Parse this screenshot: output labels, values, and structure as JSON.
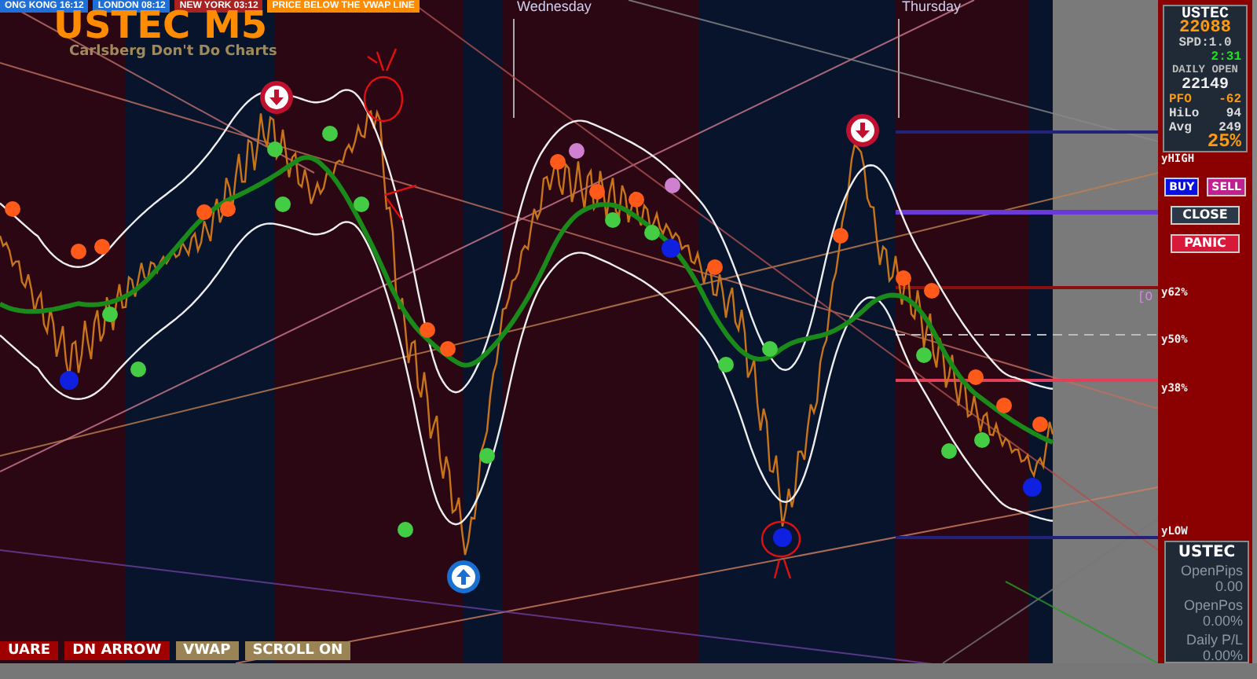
{
  "sessions": [
    {
      "label": "ONG KONG 16:12",
      "color": "#1f6fd6"
    },
    {
      "label": "LONDON 08:12",
      "color": "#1f6fd6"
    },
    {
      "label": "NEW YORK 03:12",
      "color": "#a82222"
    },
    {
      "label": "PRICE BELOW THE VWAP LINE",
      "color": "#ff8c00"
    }
  ],
  "chart": {
    "title": "USTEC M5",
    "subtitle": "Carlsberg Don't Do Charts",
    "day_labels": [
      "Wednesday",
      "Thursday"
    ],
    "order_label": "[O",
    "level_labels": [
      {
        "label": "yHIGH"
      },
      {
        "label": "y62%"
      },
      {
        "label": "y50%"
      },
      {
        "label": "y38%"
      },
      {
        "label": "yLOW"
      }
    ]
  },
  "info_panel": {
    "symbol": "USTEC",
    "price": "22088",
    "spread": "SPD:1.0",
    "timer": "2:31",
    "daily_open_label": "DAILY OPEN",
    "daily_open": "22149",
    "stats": [
      {
        "label": "PFO",
        "value": "-62",
        "kind": "accent"
      },
      {
        "label": "HiLo",
        "value": "94",
        "kind": "plain"
      },
      {
        "label": "Avg",
        "value": "249",
        "kind": "plain"
      }
    ],
    "percent": "25%"
  },
  "trade_buttons": [
    {
      "label": "BUY",
      "kind": "buy"
    },
    {
      "label": "SELL",
      "kind": "sell"
    },
    {
      "label": "CLOSE",
      "kind": "close"
    },
    {
      "label": "PANIC",
      "kind": "panic"
    }
  ],
  "position_panel": {
    "symbol": "USTEC",
    "rows": [
      {
        "label": "OpenPips",
        "value": "0.00"
      },
      {
        "label": "OpenPos",
        "value": "0.00%"
      },
      {
        "label": "Daily P/L",
        "value": "0.00%"
      }
    ]
  },
  "toolbar_buttons": [
    {
      "label": "UARE",
      "color": "#a00000"
    },
    {
      "label": "DN ARROW",
      "color": "#a00000"
    },
    {
      "label": "VWAP",
      "color": "#9a8456"
    },
    {
      "label": "SCROLL ON",
      "color": "#9a8456"
    }
  ]
}
